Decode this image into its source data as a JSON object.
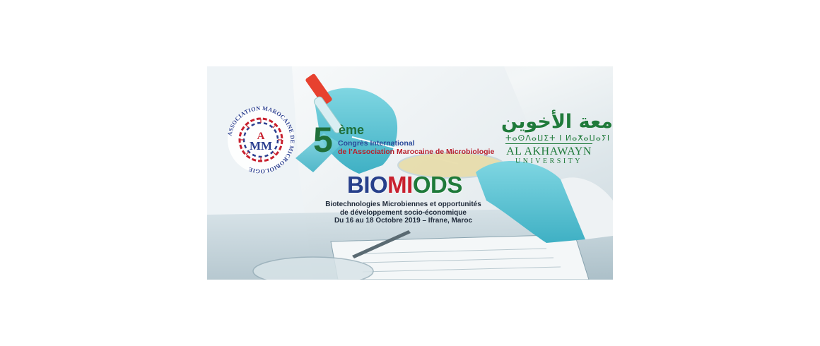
{
  "banner": {
    "amm_logo": {
      "ring_text": "ASSOCIATION MAROCAINE DE MICROBIOLOGIE",
      "monogram_top": "A",
      "monogram_bottom": "MM"
    },
    "university_logo": {
      "arabic": "جامعة الأخوين",
      "tifinagh": "ⵜⴰⵙⴷⴰⵡⵉⵜ ⵏ ⵍⴰⵅⴰⵡⴰⵢⵏ",
      "latin": "AL AKHAWAYN",
      "university": "UNIVERSITY"
    },
    "heading": {
      "number": "5",
      "ordinal": "ème",
      "line1": "Congrès International",
      "line2": "de l'Association Marocaine de Microbiologie"
    },
    "acronym": {
      "part1": "BIO",
      "part2": "MI",
      "part3": "ODS"
    },
    "subtitle": {
      "line1": "Biotechnologies Microbiennes et opportunités",
      "line2": "de développement socio-économique",
      "line3": "Du 16 au 18 Octobre 2019 – Ifrane, Maroc"
    },
    "colors": {
      "green": "#1f7a3a",
      "blue": "#27408b",
      "red": "#c8202e",
      "glove": "#5fc8d6"
    }
  }
}
